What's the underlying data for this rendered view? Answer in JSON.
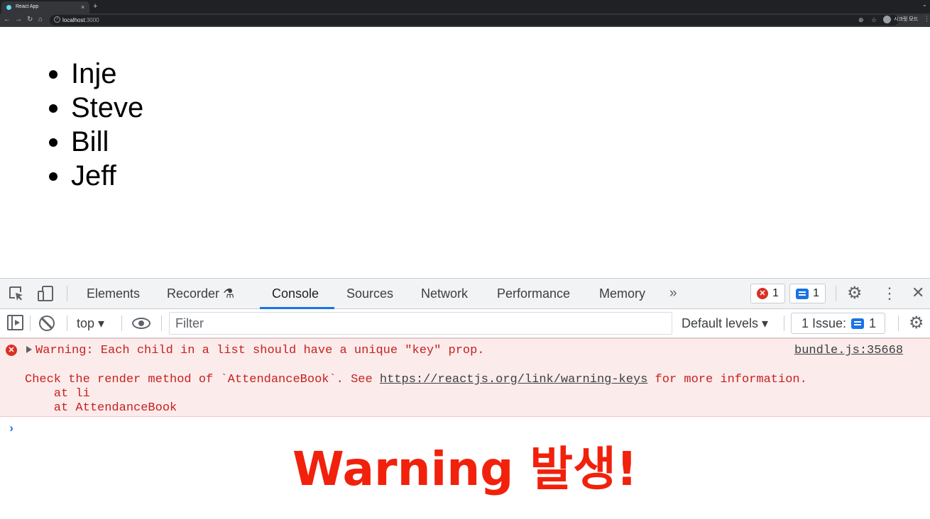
{
  "browser": {
    "tab_title": "React App",
    "tab_close": "×",
    "new_tab": "+",
    "overflow": "⌄",
    "nav": {
      "back": "←",
      "forward": "→",
      "reload": "↻",
      "home": "⌂"
    },
    "url_host": "localhost",
    "url_port": ":3000",
    "zoom_icon": "⊕",
    "star_icon": "☆",
    "profile_label": "시크릿 모드",
    "menu_icon": "⋮"
  },
  "page": {
    "names": [
      "Inje",
      "Steve",
      "Bill",
      "Jeff"
    ]
  },
  "devtools": {
    "tabs": [
      {
        "label": "Elements",
        "active": false
      },
      {
        "label": "Recorder ⚗",
        "active": false
      },
      {
        "label": "Console",
        "active": true
      },
      {
        "label": "Sources",
        "active": false
      },
      {
        "label": "Network",
        "active": false
      },
      {
        "label": "Performance",
        "active": false
      },
      {
        "label": "Memory",
        "active": false
      }
    ],
    "more_tabs": "»",
    "error_count": "1",
    "message_count": "1",
    "close": "✕",
    "kebab": "⋮",
    "gear": "⚙",
    "console_toolbar": {
      "context": "top ▾",
      "filter_placeholder": "Filter",
      "levels": "Default levels ▾",
      "issues_label": "1 Issue:",
      "issues_count": "1"
    },
    "message": {
      "error_icon": "✕",
      "line1": "Warning: Each child in a list should have a unique \"key\" prop.",
      "source": "bundle.js:35668",
      "line2_before": "Check the render method of `AttendanceBook`. See ",
      "line2_link": "https://reactjs.org/link/warning-keys",
      "line2_after": " for more information.",
      "line3": "    at li",
      "line4": "    at AttendanceBook"
    },
    "prompt": "›"
  },
  "caption": "Warning 발생!"
}
